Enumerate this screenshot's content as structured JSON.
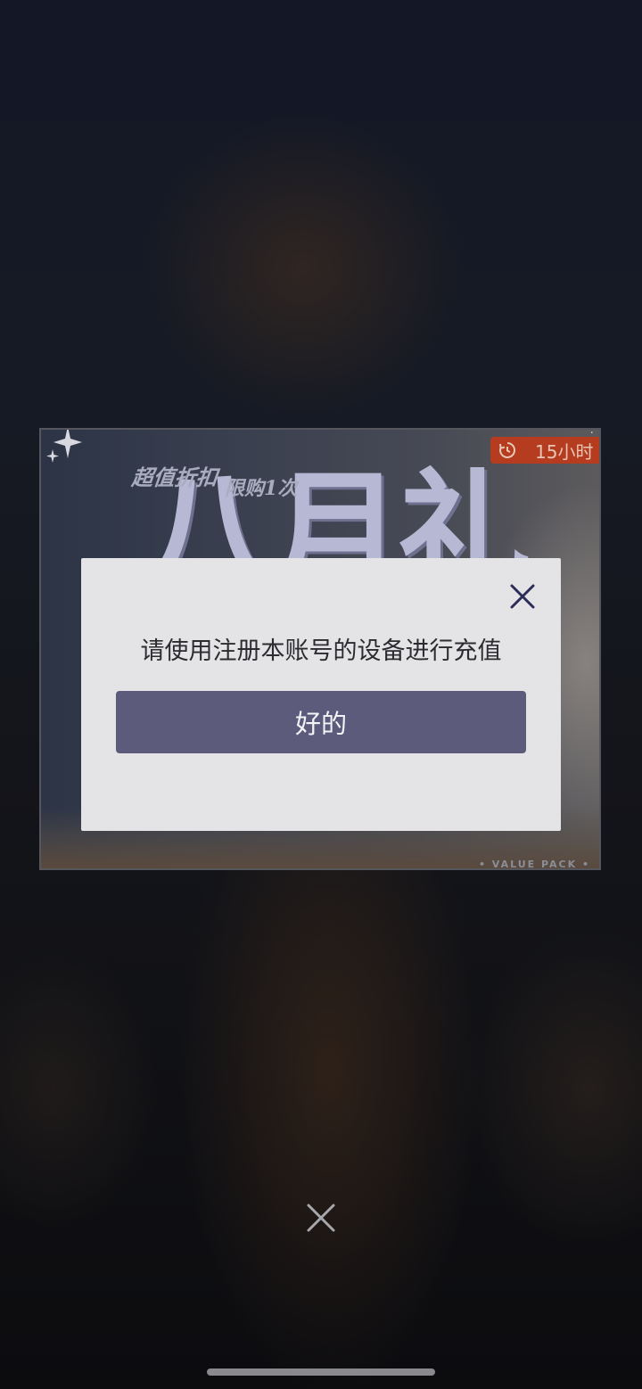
{
  "promo": {
    "subtitle_discount": "超值折扣",
    "subtitle_limit": "限购1次",
    "title": "八月礼包",
    "timer": "15小时",
    "pack_label": "• VALUE PACK •",
    "accent_color": "#b53c1e"
  },
  "dialog": {
    "message": "请使用注册本账号的设备进行充值",
    "confirm_label": "好的",
    "button_color": "#5d5b7b",
    "close_icon": "close-icon"
  },
  "overlay": {
    "close_icon": "close-icon"
  }
}
